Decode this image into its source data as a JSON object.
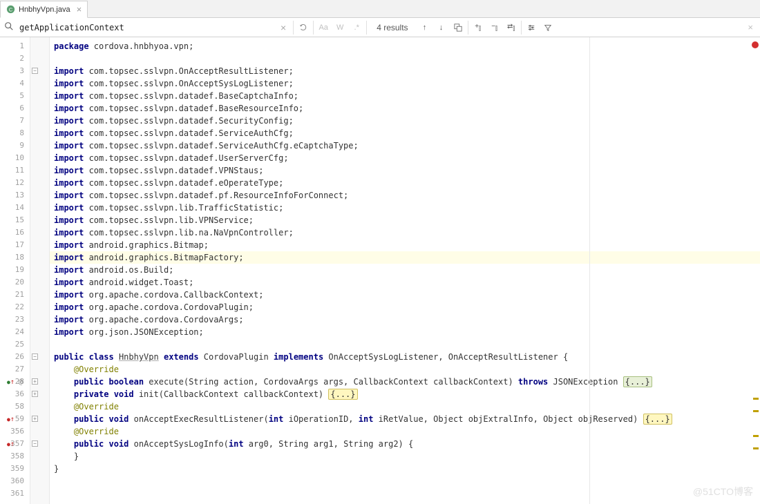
{
  "tab": {
    "filename": "HnbhyVpn.java"
  },
  "search": {
    "query": "getApplicationContext",
    "results": "4 results"
  },
  "watermark": "@51CTO博客",
  "lines": [
    {
      "n": 1,
      "tokens": [
        [
          "kw",
          "package"
        ],
        [
          "",
          " cordova.hnbhyoa.vpn;"
        ]
      ]
    },
    {
      "n": 2,
      "tokens": [
        [
          "",
          ""
        ]
      ]
    },
    {
      "n": 3,
      "fold": "-",
      "tokens": [
        [
          "kw",
          "import"
        ],
        [
          "",
          " com.topsec.sslvpn.OnAcceptResultListener;"
        ]
      ]
    },
    {
      "n": 4,
      "tokens": [
        [
          "kw",
          "import"
        ],
        [
          "",
          " com.topsec.sslvpn.OnAcceptSysLogListener;"
        ]
      ]
    },
    {
      "n": 5,
      "tokens": [
        [
          "kw",
          "import"
        ],
        [
          "",
          " com.topsec.sslvpn.datadef.BaseCaptchaInfo;"
        ]
      ]
    },
    {
      "n": 6,
      "tokens": [
        [
          "kw",
          "import"
        ],
        [
          "",
          " com.topsec.sslvpn.datadef.BaseResourceInfo;"
        ]
      ]
    },
    {
      "n": 7,
      "tokens": [
        [
          "kw",
          "import"
        ],
        [
          "",
          " com.topsec.sslvpn.datadef.SecurityConfig;"
        ]
      ]
    },
    {
      "n": 8,
      "tokens": [
        [
          "kw",
          "import"
        ],
        [
          "",
          " com.topsec.sslvpn.datadef.ServiceAuthCfg;"
        ]
      ]
    },
    {
      "n": 9,
      "tokens": [
        [
          "kw",
          "import"
        ],
        [
          "",
          " com.topsec.sslvpn.datadef.ServiceAuthCfg.eCaptchaType;"
        ]
      ]
    },
    {
      "n": 10,
      "tokens": [
        [
          "kw",
          "import"
        ],
        [
          "",
          " com.topsec.sslvpn.datadef.UserServerCfg;"
        ]
      ]
    },
    {
      "n": 11,
      "tokens": [
        [
          "kw",
          "import"
        ],
        [
          "",
          " com.topsec.sslvpn.datadef.VPNStaus;"
        ]
      ]
    },
    {
      "n": 12,
      "tokens": [
        [
          "kw",
          "import"
        ],
        [
          "",
          " com.topsec.sslvpn.datadef.eOperateType;"
        ]
      ]
    },
    {
      "n": 13,
      "tokens": [
        [
          "kw",
          "import"
        ],
        [
          "",
          " com.topsec.sslvpn.datadef.pf.ResourceInfoForConnect;"
        ]
      ]
    },
    {
      "n": 14,
      "tokens": [
        [
          "kw",
          "import"
        ],
        [
          "",
          " com.topsec.sslvpn.lib.TrafficStatistic;"
        ]
      ]
    },
    {
      "n": 15,
      "tokens": [
        [
          "kw",
          "import"
        ],
        [
          "",
          " com.topsec.sslvpn.lib.VPNService;"
        ]
      ]
    },
    {
      "n": 16,
      "tokens": [
        [
          "kw",
          "import"
        ],
        [
          "",
          " com.topsec.sslvpn.lib.na.NaVpnController;"
        ]
      ]
    },
    {
      "n": 17,
      "tokens": [
        [
          "kw",
          "import"
        ],
        [
          "",
          " android.graphics.Bitmap;"
        ]
      ]
    },
    {
      "n": 18,
      "hl": true,
      "tokens": [
        [
          "kw",
          "import"
        ],
        [
          "",
          " android.graphics.BitmapFactory;"
        ]
      ]
    },
    {
      "n": 19,
      "tokens": [
        [
          "kw",
          "import"
        ],
        [
          "",
          " android.os.Build;"
        ]
      ]
    },
    {
      "n": 20,
      "tokens": [
        [
          "kw",
          "import"
        ],
        [
          "",
          " android.widget.Toast;"
        ]
      ]
    },
    {
      "n": 21,
      "tokens": [
        [
          "kw",
          "import"
        ],
        [
          "",
          " org.apache.cordova.CallbackContext;"
        ]
      ]
    },
    {
      "n": 22,
      "tokens": [
        [
          "kw",
          "import"
        ],
        [
          "",
          " org.apache.cordova.CordovaPlugin;"
        ]
      ]
    },
    {
      "n": 23,
      "tokens": [
        [
          "kw",
          "import"
        ],
        [
          "",
          " org.apache.cordova.CordovaArgs;"
        ]
      ]
    },
    {
      "n": 24,
      "tokens": [
        [
          "kw",
          "import"
        ],
        [
          "",
          " org.json.JSONException;"
        ]
      ]
    },
    {
      "n": 25,
      "tokens": [
        [
          "",
          ""
        ]
      ]
    },
    {
      "n": 26,
      "fold": "-",
      "tokens": [
        [
          "kw",
          "public class"
        ],
        [
          "",
          " "
        ],
        [
          "u",
          "HnbhyVpn"
        ],
        [
          "",
          " "
        ],
        [
          "kw",
          "extends"
        ],
        [
          "",
          " CordovaPlugin "
        ],
        [
          "kw",
          "implements"
        ],
        [
          "",
          " OnAcceptSysLogListener, OnAcceptResultListener {"
        ]
      ]
    },
    {
      "n": 27,
      "tokens": [
        [
          "",
          "    "
        ],
        [
          "ann",
          "@Override"
        ]
      ]
    },
    {
      "n": 28,
      "fold": "+",
      "marks": "●↑@",
      "tokens": [
        [
          "",
          "    "
        ],
        [
          "kw",
          "public boolean"
        ],
        [
          "",
          " execute(String action, CordovaArgs args, CallbackContext callbackContext) "
        ],
        [
          "kw",
          "throws"
        ],
        [
          "",
          " JSONException "
        ],
        [
          "foldg",
          "{...}"
        ]
      ]
    },
    {
      "n": 36,
      "fold": "+",
      "tokens": [
        [
          "",
          "    "
        ],
        [
          "kw",
          "private void"
        ],
        [
          "",
          " init(CallbackContext callbackContext) "
        ],
        [
          "foldy",
          "{...}"
        ]
      ]
    },
    {
      "n": 58,
      "tokens": [
        [
          "",
          "    "
        ],
        [
          "ann",
          "@Override"
        ]
      ]
    },
    {
      "n": 59,
      "fold": "+",
      "marks": "●↑",
      "tokens": [
        [
          "",
          "    "
        ],
        [
          "kw",
          "public void"
        ],
        [
          "",
          " onAcceptExecResultListener("
        ],
        [
          "kw",
          "int"
        ],
        [
          "",
          " iOperationID, "
        ],
        [
          "kw",
          "int"
        ],
        [
          "",
          " iRetValue, Object objExtralInfo, Object objReserved) "
        ],
        [
          "foldy",
          "{...}"
        ]
      ]
    },
    {
      "n": 356,
      "tokens": [
        [
          "",
          "    "
        ],
        [
          "ann",
          "@Override"
        ]
      ]
    },
    {
      "n": 357,
      "fold": "-",
      "marks": "●↑",
      "tokens": [
        [
          "",
          "    "
        ],
        [
          "kw",
          "public void"
        ],
        [
          "",
          " onAcceptSysLogInfo("
        ],
        [
          "kw",
          "int"
        ],
        [
          "",
          " arg0, String arg1, String arg2) {"
        ]
      ]
    },
    {
      "n": 358,
      "tokens": [
        [
          "",
          "    }"
        ]
      ]
    },
    {
      "n": 359,
      "tokens": [
        [
          "",
          "}"
        ]
      ]
    },
    {
      "n": 360,
      "tokens": [
        [
          "",
          ""
        ]
      ]
    },
    {
      "n": 361,
      "tokens": [
        [
          "",
          ""
        ]
      ]
    }
  ],
  "warn_markers": [
    522,
    540,
    576,
    594
  ]
}
